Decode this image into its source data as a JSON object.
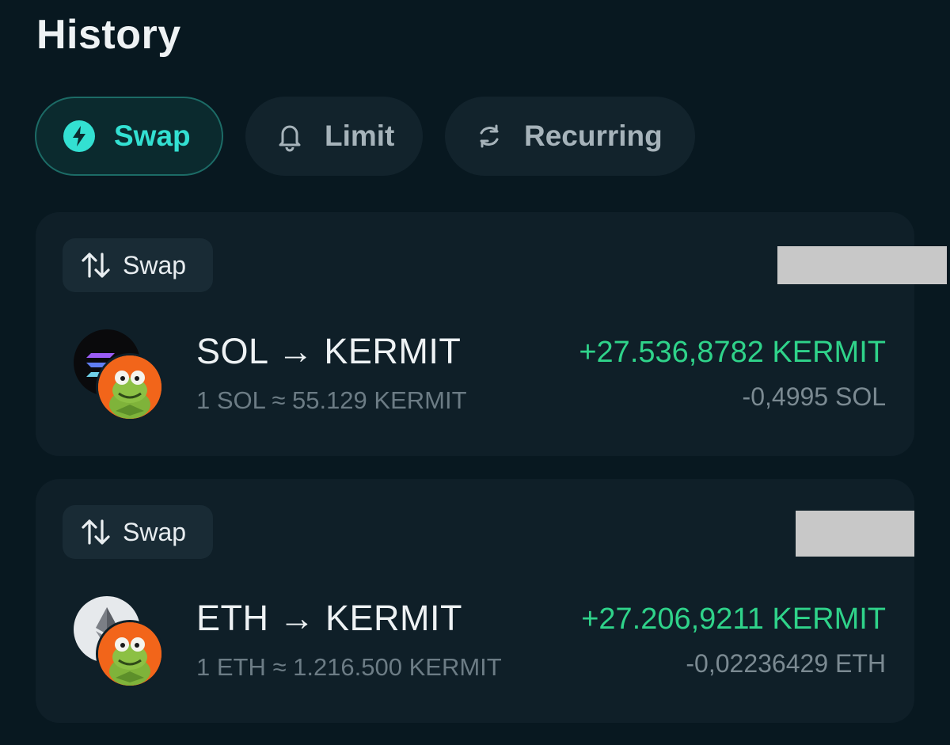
{
  "header": {
    "title": "History"
  },
  "tabs": [
    {
      "label": "Swap",
      "icon": "lightning-icon",
      "active": true
    },
    {
      "label": "Limit",
      "icon": "bell-icon",
      "active": false
    },
    {
      "label": "Recurring",
      "icon": "refresh-icon",
      "active": false
    }
  ],
  "transactions": [
    {
      "type_label": "Swap",
      "pair": "SOL → KERMIT",
      "rate": "1 SOL ≈  55.129 KERMIT",
      "amount_in": "+27.536,8782 KERMIT",
      "amount_out": "-0,4995 SOL",
      "from_token_icon": "solana-logo-icon",
      "to_token_icon": "kermit-avatar-icon"
    },
    {
      "type_label": "Swap",
      "pair": "ETH → KERMIT",
      "rate": "1 ETH ≈  1.216.500 KERMIT",
      "amount_in": "+27.206,9211 KERMIT",
      "amount_out": "-0,02236429 ETH",
      "from_token_icon": "ethereum-logo-icon",
      "to_token_icon": "kermit-avatar-icon"
    }
  ],
  "colors": {
    "background": "#081820",
    "accent": "#33e0d2",
    "positive": "#2fd38a",
    "card": "#0f1f28"
  }
}
